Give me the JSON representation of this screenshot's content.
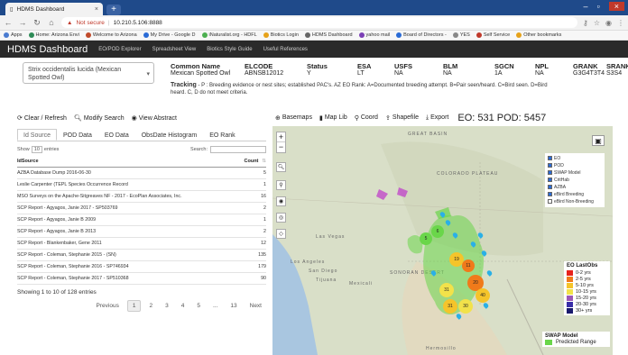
{
  "browser": {
    "tab_title": "HDMS Dashboard",
    "url_warning": "Not secure",
    "url_host": "10.210.5.106:8888",
    "bookmarks": [
      "Apps",
      "Home: Arizona Envi",
      "Welcome to Arizona",
      "My Drive - Google D",
      "iNaturalist.org - HDFL",
      "Biotics Login",
      "HDMS Dashboard",
      "yahoo mail",
      "Board of Directors -",
      "YES",
      "Self Service",
      "Other bookmarks"
    ]
  },
  "app": {
    "brand": "HDMS Dashboard",
    "nav": [
      "EO/POD Explorer",
      "Spreadsheet View",
      "Biotics Style Guide",
      "Useful References"
    ]
  },
  "species": {
    "selector": "Strix occidentalis lucida (Mexican Spotted Owl)",
    "columns": [
      {
        "head": "Common Name",
        "value": "Mexican Spotted Owl"
      },
      {
        "head": "ELCODE",
        "value": "ABNSB12012"
      },
      {
        "head": "Status",
        "value": "Y"
      },
      {
        "head": "ESA",
        "value": "LT"
      },
      {
        "head": "USFS",
        "value": "NA"
      },
      {
        "head": "BLM",
        "value": "NA"
      },
      {
        "head": "SGCN",
        "value": "1A"
      },
      {
        "head": "NPL",
        "value": "NA"
      },
      {
        "head": "GRANK",
        "value": "G3G4T3T4"
      },
      {
        "head": "SRANK",
        "value": "S3S4"
      }
    ],
    "tracking_label": "Tracking",
    "tracking_text": " - P : Breeding evidence or nest sites; established PAC's. AZ EO Rank: A=Documented breeding attempt. B=Pair seen/heard. C=Bird seen. D=Bird heard. C, D do not meet criteria."
  },
  "panel": {
    "buttons": [
      "Clear / Refresh",
      "Modify Search",
      "View Abstract"
    ],
    "tabs": [
      "Id Source",
      "POD Data",
      "EO Data",
      "ObsDate Histogram",
      "EO Rank"
    ],
    "show_label": "Show",
    "show_value": "10",
    "entries_label": "entries",
    "search_label": "Search:",
    "table_headers": [
      "IdSource",
      "Count"
    ],
    "rows": [
      {
        "source": "AZBA Database Dump 2016-06-30",
        "count": "5"
      },
      {
        "source": "Leslie Carpenter (TEPL Species Occurrence Record",
        "count": "1"
      },
      {
        "source": "MSO Surveys on the Apache-Sitgreaves NF - 2017 - EcoPlan Associates, Inc.",
        "count": "16"
      },
      {
        "source": "SCP Report - Agyagos, Janie 2017 - SP503769",
        "count": "2"
      },
      {
        "source": "SCP Report - Agyagos, Janie B 2009",
        "count": "1"
      },
      {
        "source": "SCP Report - Agyagos, Janie B 2013",
        "count": "2"
      },
      {
        "source": "SCP Report - Blankenbaker, Gene 2011",
        "count": "12"
      },
      {
        "source": "SCP Report - Coleman, Stephanie 2015 - (SN)",
        "count": "135"
      },
      {
        "source": "SCP Report - Coleman, Stephanie 2016 - SP746934",
        "count": "179"
      },
      {
        "source": "SCP Report - Coleman, Stephanie 2017 - SP510368",
        "count": "90"
      }
    ],
    "entries_info": "Showing 1 to 10 of 128 entries",
    "pager": [
      "Previous",
      "1",
      "2",
      "3",
      "4",
      "5",
      "...",
      "13",
      "Next"
    ]
  },
  "map": {
    "tools": [
      "Basemaps",
      "Map Lib",
      "Coord",
      "Shapefile",
      "Export"
    ],
    "counts": "EO: 531 POD: 5457",
    "labels": [
      "GREAT BASIN",
      "COLORADO PLATEAU",
      "Las Vegas",
      "Los Angeles",
      "San Diego",
      "Tijuana",
      "Mexicali",
      "SONORAN DESERT",
      "Hermosillo"
    ],
    "layers": [
      {
        "label": "EO",
        "on": true
      },
      {
        "label": "POD",
        "on": true
      },
      {
        "label": "SWAP Model",
        "on": true
      },
      {
        "label": "CritHab",
        "on": true
      },
      {
        "label": "AZBA",
        "on": true
      },
      {
        "label": "eBird Breeding",
        "on": true
      },
      {
        "label": "eBird Non-Breeding",
        "on": false
      }
    ],
    "legend_title": "EO LastObs",
    "legend": [
      {
        "label": "0-2 yrs",
        "color": "#e8231b"
      },
      {
        "label": "2-5 yrs",
        "color": "#f07a1a"
      },
      {
        "label": "5-10 yrs",
        "color": "#f5c42a"
      },
      {
        "label": "10-15 yrs",
        "color": "#f2e24a"
      },
      {
        "label": "15-20 yrs",
        "color": "#9b59b6"
      },
      {
        "label": "20-30 yrs",
        "color": "#3a2ea8"
      },
      {
        "label": "30+ yrs",
        "color": "#1a1a6e"
      }
    ],
    "swap_title": "SWAP Model",
    "swap_item": "Predicted Range",
    "swap_color": "#6ad64a",
    "clusters": [
      "5",
      "6",
      "19",
      "11",
      "31",
      "20",
      "40",
      "31",
      "30"
    ]
  }
}
